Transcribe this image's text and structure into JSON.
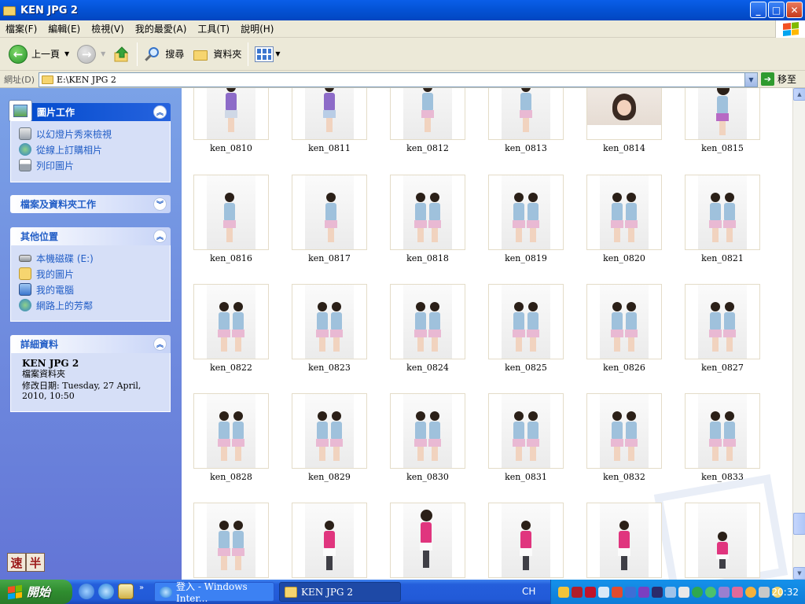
{
  "window": {
    "title": "KEN JPG 2",
    "buttons": {
      "minimize": "_",
      "maximize": "□",
      "close": "✕"
    }
  },
  "menu": [
    "檔案(F)",
    "編輯(E)",
    "檢視(V)",
    "我的最愛(A)",
    "工具(T)",
    "說明(H)"
  ],
  "toolbar": {
    "back_label": "上一頁",
    "search_label": "搜尋",
    "folders_label": "資料夾"
  },
  "address": {
    "label": "網址(D)",
    "path": "E:\\KEN JPG 2",
    "go_label": "移至"
  },
  "sidebar": {
    "picture_tasks": {
      "title": "圖片工作",
      "items": [
        "以幻燈片秀來檢視",
        "從線上訂購相片",
        "列印圖片"
      ]
    },
    "file_tasks": {
      "title": "檔案及資料夾工作"
    },
    "other_places": {
      "title": "其他位置",
      "items": [
        "本機磁碟 (E:)",
        "我的圖片",
        "我的電腦",
        "網路上的芳鄰"
      ]
    },
    "details": {
      "title": "詳細資料",
      "name": "KEN JPG 2",
      "type": "檔案資料夾",
      "modified": "修改日期: Tuesday, 27 April, 2010, 10:50"
    }
  },
  "ime": {
    "mode": "速",
    "width": "半"
  },
  "thumbnails": {
    "row1": [
      "ken_0810",
      "ken_0811",
      "ken_0812",
      "ken_0813",
      "ken_0814",
      "ken_0815"
    ],
    "row2": [
      "ken_0816",
      "ken_0817",
      "ken_0818",
      "ken_0819",
      "ken_0820",
      "ken_0821"
    ],
    "row3": [
      "ken_0822",
      "ken_0823",
      "ken_0824",
      "ken_0825",
      "ken_0826",
      "ken_0827"
    ],
    "row4": [
      "ken_0828",
      "ken_0829",
      "ken_0830",
      "ken_0831",
      "ken_0832",
      "ken_0833"
    ]
  },
  "taskbar": {
    "start_label": "開始",
    "tasks": [
      "登入 - Windows Inter...",
      "KEN JPG 2"
    ],
    "language": "CH",
    "clock": "20:32"
  },
  "colors": {
    "titlebar": "#0453d6",
    "sidebar": "#6f8ade",
    "link": "#215dc6",
    "taskbar": "#245edb",
    "start": "#2f8c2f"
  }
}
